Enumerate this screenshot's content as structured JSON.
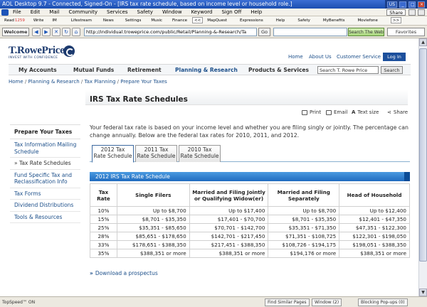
{
  "window": {
    "title": "AOL Desktop 9.7 - Connected, Signed-On - [IRS tax rate schedule, based on income level or household role.]",
    "tray": {
      "region": "US",
      "share": "Share"
    }
  },
  "menu": [
    "File",
    "Edit",
    "Mail",
    "Community",
    "Services",
    "Safety",
    "Window",
    "Keyword",
    "Sign Off",
    "Help"
  ],
  "toolbar": {
    "read": "Read",
    "read_count": "1259",
    "write": "Write",
    "im": "IM",
    "items": [
      "Lifestream",
      "News",
      "Settings",
      "Music",
      "Finance"
    ],
    "items2": [
      "MapQuest",
      "Expressions",
      "Help",
      "Safety",
      "MyBenefits",
      "Moviefone"
    ]
  },
  "address": {
    "welcome": "Welcome",
    "url": "http://individual.troweprice.com/public/Retail/Planning-&-Research/Ta",
    "go": "Go",
    "search_web": "Search The Web",
    "favorites": "Favorites"
  },
  "site": {
    "brand": "T.RowePrice",
    "tagline": "INVEST WITH CONFIDENCE",
    "toplinks": [
      "Home",
      "About Us",
      "Customer Service"
    ],
    "login": "Log In",
    "nav": [
      "My Accounts",
      "Mutual Funds",
      "Retirement",
      "Planning & Research",
      "Products & Services"
    ],
    "search_placeholder": "Search T. Rowe Price",
    "search_button": "Search"
  },
  "breadcrumb": [
    "Home",
    "Planning & Research",
    "Tax Planning",
    "Prepare Your Taxes"
  ],
  "page": {
    "title": "IRS Tax Rate Schedules",
    "tools": [
      "Print",
      "Email",
      "Text size",
      "Share"
    ],
    "intro": "Your federal tax rate is based on your income level and whether you are filing singly or jointly. The percentage can change annually. Below are the federal tax rates for 2010, 2011, and 2012."
  },
  "sidenav": {
    "head": "Prepare Your Taxes",
    "items": [
      "Tax Information Mailing Schedule",
      "» Tax Rate Schedules",
      "Fund Specific Tax and Reclassification Info",
      "Tax Forms",
      "Dividend Distributions",
      "Tools & Resources"
    ]
  },
  "tabs": [
    {
      "line1": "2012 Tax",
      "line2": "Rate Schedule"
    },
    {
      "line1": "2011 Tax",
      "line2": "Rate Schedule"
    },
    {
      "line1": "2010 Tax",
      "line2": "Rate Schedule"
    }
  ],
  "table": {
    "caption": "2012 IRS Tax Rate Schedule",
    "headers": [
      "Tax Rate",
      "Single Filers",
      "Married and Filing Jointly or Qualifying Widow(er)",
      "Married and Filing Separately",
      "Head of Household"
    ],
    "rows": [
      [
        "10%",
        "Up to $8,700",
        "Up to $17,400",
        "Up to $8,700",
        "Up to $12,400"
      ],
      [
        "15%",
        "$8,701 - $35,350",
        "$17,401 - $70,700",
        "$8,701 - $35,350",
        "$12,401 - $47,350"
      ],
      [
        "25%",
        "$35,351 - $85,650",
        "$70,701 - $142,700",
        "$35,351 - $71,350",
        "$47,351 - $122,300"
      ],
      [
        "28%",
        "$85,651 - $178,650",
        "$142,701 - $217,450",
        "$71,351 - $108,725",
        "$122,301 - $198,050"
      ],
      [
        "33%",
        "$178,651 - $388,350",
        "$217,451 - $388,350",
        "$108,726 - $194,175",
        "$198,051 - $388,350"
      ],
      [
        "35%",
        "$388,351 or more",
        "$388,351 or more",
        "$194,176 or more",
        "$388,351 or more"
      ]
    ]
  },
  "prospectus": "Download a prospectus",
  "status": {
    "topspeed": "TopSpeed™ ON",
    "find": "Find Similar Pages",
    "window": "Window (2)",
    "popups": "Blocking Pop-ups (0)"
  }
}
